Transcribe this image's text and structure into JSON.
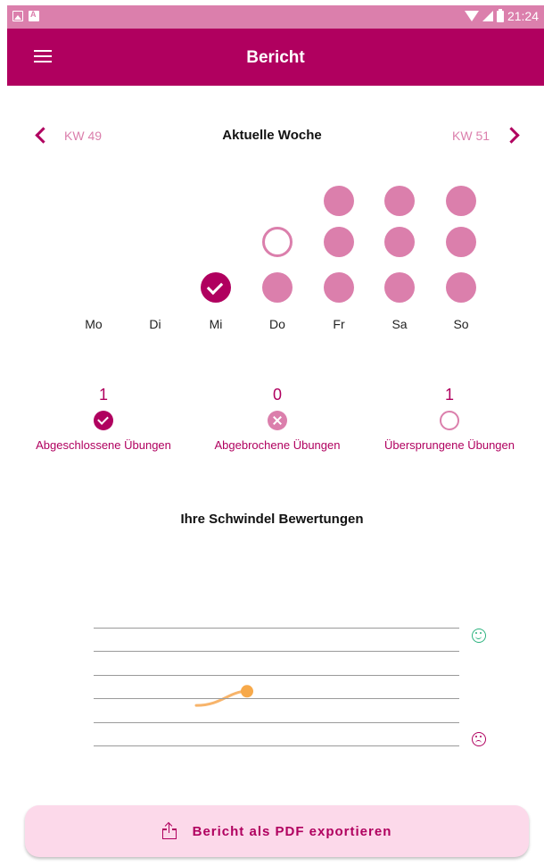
{
  "status_bar": {
    "time": "21:24",
    "icons": [
      "gallery-icon",
      "a-icon",
      "wifi-icon",
      "signal-icon",
      "battery-icon"
    ]
  },
  "app_bar": {
    "title": "Bericht",
    "menu_icon": "hamburger-menu-icon"
  },
  "week_nav": {
    "prev_label": "KW 49",
    "next_label": "KW 51",
    "title": "Aktuelle Woche"
  },
  "days": [
    {
      "label": "Mo",
      "slots": []
    },
    {
      "label": "Di",
      "slots": []
    },
    {
      "label": "Mi",
      "slots": [
        "completed"
      ]
    },
    {
      "label": "Do",
      "slots": [
        "planned",
        "skipped"
      ]
    },
    {
      "label": "Fr",
      "slots": [
        "planned",
        "planned",
        "planned"
      ]
    },
    {
      "label": "Sa",
      "slots": [
        "planned",
        "planned",
        "planned"
      ]
    },
    {
      "label": "So",
      "slots": [
        "planned",
        "planned",
        "planned"
      ]
    }
  ],
  "stats": [
    {
      "count": "1",
      "icon": "check-circle-icon",
      "label": "Abgeschlossene Übungen"
    },
    {
      "count": "0",
      "icon": "cancel-circle-icon",
      "label": "Abgebrochene Übungen"
    },
    {
      "count": "1",
      "icon": "empty-circle-icon",
      "label": "Übersprungene Übungen"
    }
  ],
  "ratings": {
    "title": "Ihre Schwindel Bewertungen",
    "top_icon": "happy-face-icon",
    "bottom_icon": "sad-face-icon"
  },
  "chart_data": {
    "type": "line",
    "title": "Ihre Schwindel Bewertungen",
    "xlabel": "",
    "ylabel": "",
    "ylim": [
      0,
      5
    ],
    "grid": true,
    "series": [
      {
        "x": [
          0,
          1
        ],
        "values": [
          1.7,
          2.3
        ]
      }
    ]
  },
  "export": {
    "label": "Bericht als PDF exportieren",
    "icon": "share-icon"
  },
  "colors": {
    "primary": "#b0005f",
    "accent": "#db7fac",
    "button_bg": "#fcd9ea",
    "happy": "#2db37f"
  }
}
